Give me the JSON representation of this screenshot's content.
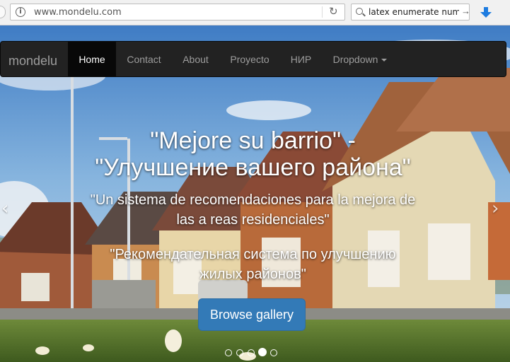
{
  "browser": {
    "url": "www.mondelu.com",
    "search_value": "latex enumerate numbe",
    "icons": [
      "info-icon",
      "reload-icon",
      "search-icon",
      "download-icon"
    ]
  },
  "navbar": {
    "brand": "mondelu",
    "items": [
      {
        "label": "Home",
        "active": true
      },
      {
        "label": "Contact"
      },
      {
        "label": "About"
      },
      {
        "label": "Proyecto"
      },
      {
        "label": "НИР"
      },
      {
        "label": "Dropdown",
        "has_caret": true
      }
    ]
  },
  "carousel": {
    "title_line1": "\"Mejore su barrio\" -",
    "title_line2": "\"Улучшение вашего района\"",
    "subtitle_es_line1": "\"Un sistema de recomendaciones para la mejora de",
    "subtitle_es_line2": "las a reas residenciales\"",
    "subtitle_ru_line1": "\"Рекомендательная система по улучшению",
    "subtitle_ru_line2": "жилых районов\"",
    "button_label": "Browse gallery",
    "prev_icon": "‹",
    "next_icon": "›",
    "slide_count": 5,
    "active_slide": 4
  },
  "colors": {
    "navbar_bg": "#222222",
    "navbar_active": "#080808",
    "button_primary": "#337ab7"
  }
}
